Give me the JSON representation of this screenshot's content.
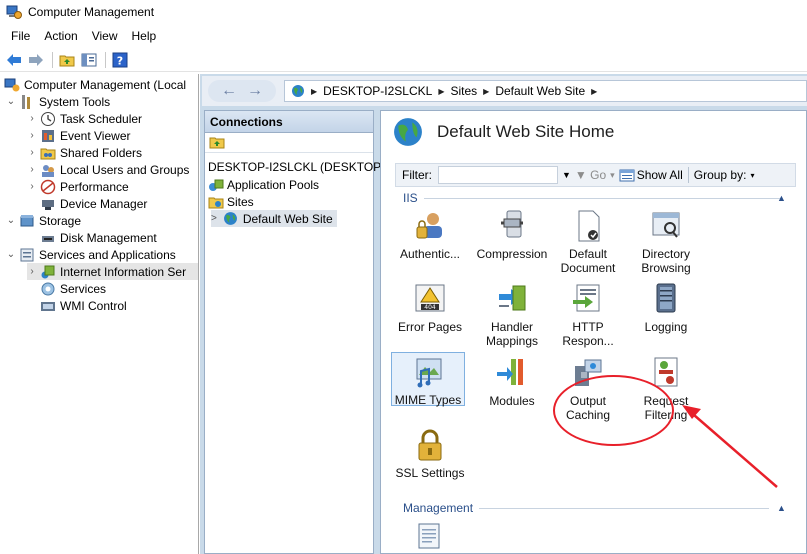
{
  "window": {
    "title": "Computer Management"
  },
  "menu": [
    "File",
    "Action",
    "View",
    "Help"
  ],
  "tree": {
    "items": [
      {
        "label": "Computer Management (Local",
        "level": 0,
        "expander": ""
      },
      {
        "label": "System Tools",
        "level": 1,
        "expander": "v"
      },
      {
        "label": "Task Scheduler",
        "level": 2,
        "expander": ">"
      },
      {
        "label": "Event Viewer",
        "level": 2,
        "expander": ">"
      },
      {
        "label": "Shared Folders",
        "level": 2,
        "expander": ">"
      },
      {
        "label": "Local Users and Groups",
        "level": 2,
        "expander": ">"
      },
      {
        "label": "Performance",
        "level": 2,
        "expander": ">"
      },
      {
        "label": "Device Manager",
        "level": 2,
        "expander": ""
      },
      {
        "label": "Storage",
        "level": 1,
        "expander": "v"
      },
      {
        "label": "Disk Management",
        "level": 2,
        "expander": ""
      },
      {
        "label": "Services and Applications",
        "level": 1,
        "expander": "v"
      },
      {
        "label": "Internet Information Ser",
        "level": 2,
        "expander": ">",
        "selected": true
      },
      {
        "label": "Services",
        "level": 2,
        "expander": ""
      },
      {
        "label": "WMI Control",
        "level": 2,
        "expander": ""
      }
    ]
  },
  "address": {
    "crumbs": [
      "DESKTOP-I2SLCKL",
      "Sites",
      "Default Web Site"
    ]
  },
  "connections": {
    "title": "Connections",
    "items": [
      {
        "label": "DESKTOP-I2SLCKL (DESKTOP-"
      },
      {
        "label": "Application Pools"
      },
      {
        "label": "Sites"
      },
      {
        "label": "Default Web Site",
        "selected": true
      }
    ]
  },
  "home": {
    "title": "Default Web Site Home",
    "filter": {
      "label": "Filter:",
      "value": "",
      "go": "Go",
      "show_all": "Show All",
      "group_by": "Group by:"
    },
    "groups": [
      {
        "name": "IIS",
        "features": [
          [
            "Authentic...",
            ""
          ],
          [
            "Compression",
            ""
          ],
          [
            "Default",
            "Document"
          ],
          [
            "Directory",
            "Browsing"
          ],
          [
            "Error Pages",
            ""
          ],
          [
            "Handler",
            "Mappings"
          ],
          [
            "HTTP",
            "Respon..."
          ],
          [
            "Logging",
            ""
          ],
          [
            "MIME Types",
            ""
          ],
          [
            "Modules",
            ""
          ],
          [
            "Output",
            "Caching"
          ],
          [
            "Request",
            "Filtering"
          ],
          [
            "SSL Settings",
            ""
          ]
        ]
      },
      {
        "name": "Management",
        "features": []
      }
    ]
  },
  "colors": {
    "annotation": "#e8202a",
    "accent": "#2a4f8a",
    "pane_bg": "#c9dae9"
  }
}
